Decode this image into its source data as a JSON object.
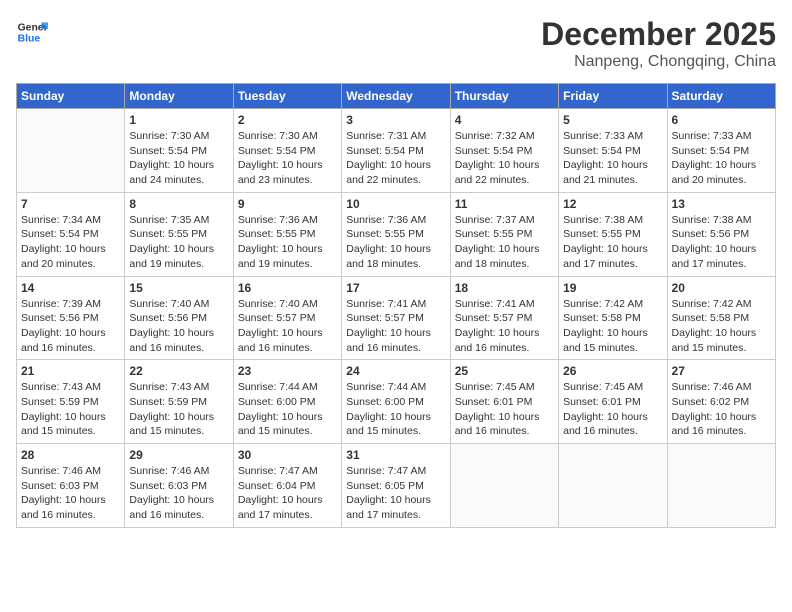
{
  "header": {
    "logo_line1": "General",
    "logo_line2": "Blue",
    "month": "December 2025",
    "location": "Nanpeng, Chongqing, China"
  },
  "days_of_week": [
    "Sunday",
    "Monday",
    "Tuesday",
    "Wednesday",
    "Thursday",
    "Friday",
    "Saturday"
  ],
  "weeks": [
    [
      {
        "day": "",
        "detail": ""
      },
      {
        "day": "1",
        "detail": "Sunrise: 7:30 AM\nSunset: 5:54 PM\nDaylight: 10 hours\nand 24 minutes."
      },
      {
        "day": "2",
        "detail": "Sunrise: 7:30 AM\nSunset: 5:54 PM\nDaylight: 10 hours\nand 23 minutes."
      },
      {
        "day": "3",
        "detail": "Sunrise: 7:31 AM\nSunset: 5:54 PM\nDaylight: 10 hours\nand 22 minutes."
      },
      {
        "day": "4",
        "detail": "Sunrise: 7:32 AM\nSunset: 5:54 PM\nDaylight: 10 hours\nand 22 minutes."
      },
      {
        "day": "5",
        "detail": "Sunrise: 7:33 AM\nSunset: 5:54 PM\nDaylight: 10 hours\nand 21 minutes."
      },
      {
        "day": "6",
        "detail": "Sunrise: 7:33 AM\nSunset: 5:54 PM\nDaylight: 10 hours\nand 20 minutes."
      }
    ],
    [
      {
        "day": "7",
        "detail": "Sunrise: 7:34 AM\nSunset: 5:54 PM\nDaylight: 10 hours\nand 20 minutes."
      },
      {
        "day": "8",
        "detail": "Sunrise: 7:35 AM\nSunset: 5:55 PM\nDaylight: 10 hours\nand 19 minutes."
      },
      {
        "day": "9",
        "detail": "Sunrise: 7:36 AM\nSunset: 5:55 PM\nDaylight: 10 hours\nand 19 minutes."
      },
      {
        "day": "10",
        "detail": "Sunrise: 7:36 AM\nSunset: 5:55 PM\nDaylight: 10 hours\nand 18 minutes."
      },
      {
        "day": "11",
        "detail": "Sunrise: 7:37 AM\nSunset: 5:55 PM\nDaylight: 10 hours\nand 18 minutes."
      },
      {
        "day": "12",
        "detail": "Sunrise: 7:38 AM\nSunset: 5:55 PM\nDaylight: 10 hours\nand 17 minutes."
      },
      {
        "day": "13",
        "detail": "Sunrise: 7:38 AM\nSunset: 5:56 PM\nDaylight: 10 hours\nand 17 minutes."
      }
    ],
    [
      {
        "day": "14",
        "detail": "Sunrise: 7:39 AM\nSunset: 5:56 PM\nDaylight: 10 hours\nand 16 minutes."
      },
      {
        "day": "15",
        "detail": "Sunrise: 7:40 AM\nSunset: 5:56 PM\nDaylight: 10 hours\nand 16 minutes."
      },
      {
        "day": "16",
        "detail": "Sunrise: 7:40 AM\nSunset: 5:57 PM\nDaylight: 10 hours\nand 16 minutes."
      },
      {
        "day": "17",
        "detail": "Sunrise: 7:41 AM\nSunset: 5:57 PM\nDaylight: 10 hours\nand 16 minutes."
      },
      {
        "day": "18",
        "detail": "Sunrise: 7:41 AM\nSunset: 5:57 PM\nDaylight: 10 hours\nand 16 minutes."
      },
      {
        "day": "19",
        "detail": "Sunrise: 7:42 AM\nSunset: 5:58 PM\nDaylight: 10 hours\nand 15 minutes."
      },
      {
        "day": "20",
        "detail": "Sunrise: 7:42 AM\nSunset: 5:58 PM\nDaylight: 10 hours\nand 15 minutes."
      }
    ],
    [
      {
        "day": "21",
        "detail": "Sunrise: 7:43 AM\nSunset: 5:59 PM\nDaylight: 10 hours\nand 15 minutes."
      },
      {
        "day": "22",
        "detail": "Sunrise: 7:43 AM\nSunset: 5:59 PM\nDaylight: 10 hours\nand 15 minutes."
      },
      {
        "day": "23",
        "detail": "Sunrise: 7:44 AM\nSunset: 6:00 PM\nDaylight: 10 hours\nand 15 minutes."
      },
      {
        "day": "24",
        "detail": "Sunrise: 7:44 AM\nSunset: 6:00 PM\nDaylight: 10 hours\nand 15 minutes."
      },
      {
        "day": "25",
        "detail": "Sunrise: 7:45 AM\nSunset: 6:01 PM\nDaylight: 10 hours\nand 16 minutes."
      },
      {
        "day": "26",
        "detail": "Sunrise: 7:45 AM\nSunset: 6:01 PM\nDaylight: 10 hours\nand 16 minutes."
      },
      {
        "day": "27",
        "detail": "Sunrise: 7:46 AM\nSunset: 6:02 PM\nDaylight: 10 hours\nand 16 minutes."
      }
    ],
    [
      {
        "day": "28",
        "detail": "Sunrise: 7:46 AM\nSunset: 6:03 PM\nDaylight: 10 hours\nand 16 minutes."
      },
      {
        "day": "29",
        "detail": "Sunrise: 7:46 AM\nSunset: 6:03 PM\nDaylight: 10 hours\nand 16 minutes."
      },
      {
        "day": "30",
        "detail": "Sunrise: 7:47 AM\nSunset: 6:04 PM\nDaylight: 10 hours\nand 17 minutes."
      },
      {
        "day": "31",
        "detail": "Sunrise: 7:47 AM\nSunset: 6:05 PM\nDaylight: 10 hours\nand 17 minutes."
      },
      {
        "day": "",
        "detail": ""
      },
      {
        "day": "",
        "detail": ""
      },
      {
        "day": "",
        "detail": ""
      }
    ]
  ]
}
